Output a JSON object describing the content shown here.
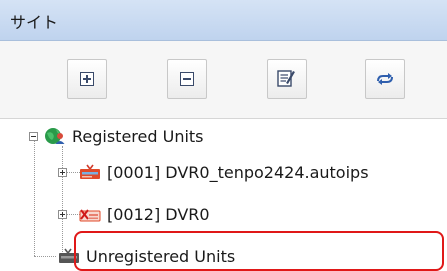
{
  "panel": {
    "title": "サイト"
  },
  "toolbar": {
    "buttons": [
      {
        "name": "expand-all",
        "icon": "plus-box-icon"
      },
      {
        "name": "collapse-all",
        "icon": "minus-box-icon"
      },
      {
        "name": "edit",
        "icon": "edit-icon"
      },
      {
        "name": "refresh",
        "icon": "refresh-icon"
      }
    ]
  },
  "tree": {
    "root_label": "Registered Units",
    "units": [
      {
        "label": "[0001] DVR0_tenpo2424.autoips"
      },
      {
        "label": "[0012] DVR0"
      }
    ],
    "unregistered_label": "Unregistered Units"
  },
  "colors": {
    "header": "#c9daf2",
    "highlight": "#e01818",
    "dvr_red": "#e04a2a"
  }
}
